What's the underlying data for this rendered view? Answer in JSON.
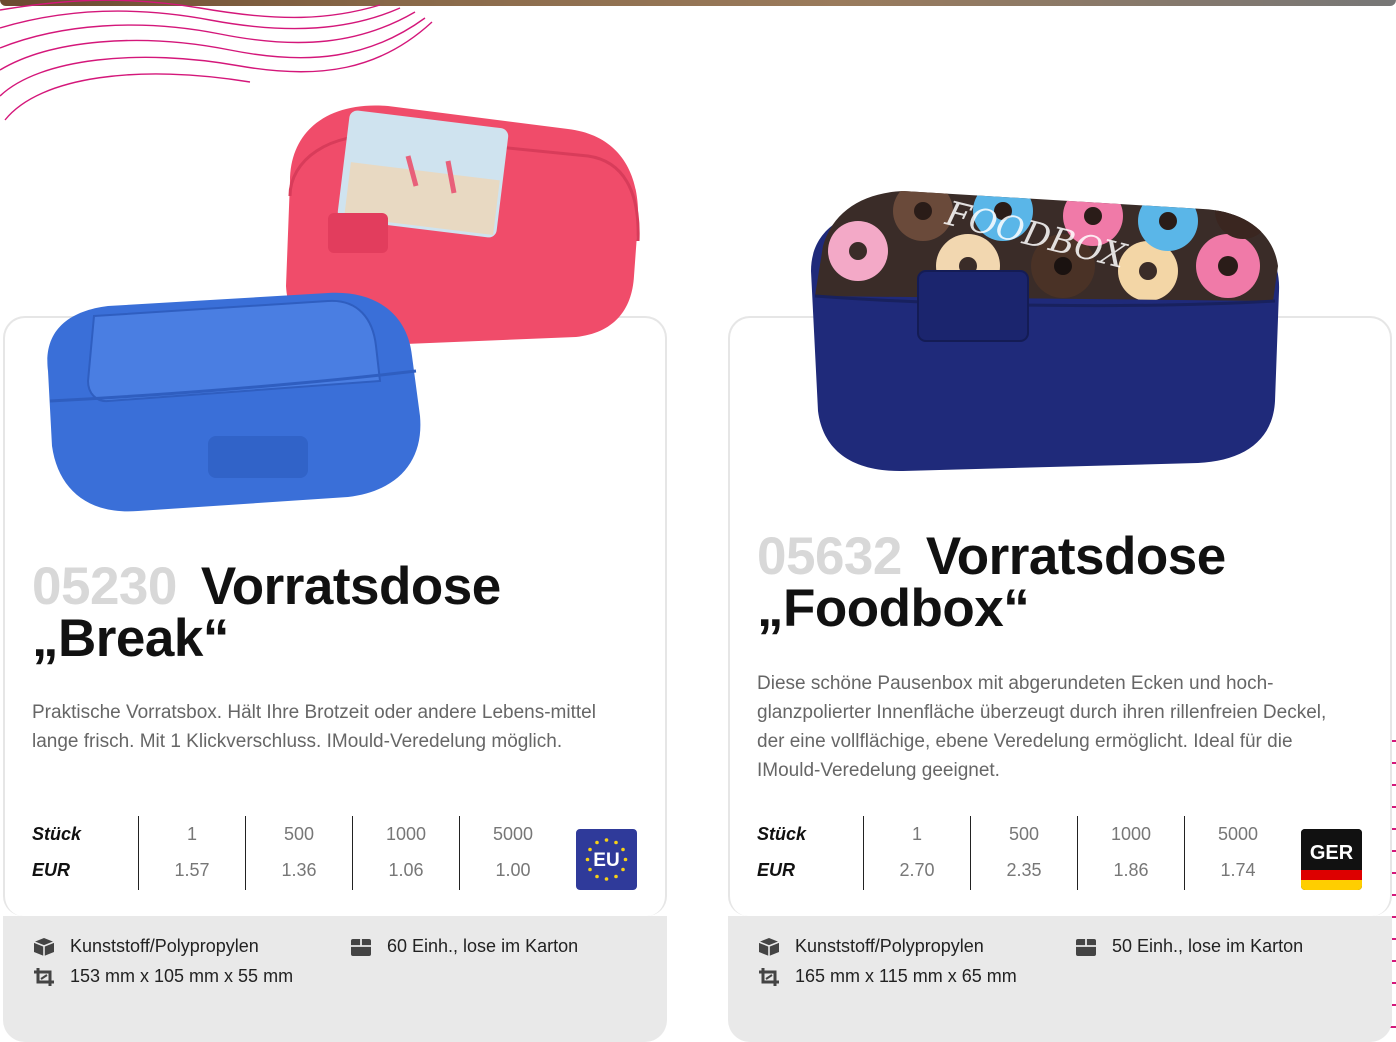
{
  "products": [
    {
      "number": "05230",
      "name_line1": "Vorratsdose",
      "name_line2": "„Break“",
      "description": "Praktische Vorratsbox. Hält Ihre Brotzeit oder andere Lebens-mittel lange frisch. Mit 1 Klickverschluss. IMould-Veredelung möglich.",
      "price_labels": {
        "qty": "Stück",
        "currency": "EUR"
      },
      "quantities": [
        "1",
        "500",
        "1000",
        "5000"
      ],
      "prices": [
        "1.57",
        "1.36",
        "1.06",
        "1.00"
      ],
      "origin_badge": "EU",
      "material": "Kunststoff/Polypropylen",
      "dimensions": "153 mm x 105 mm x 55 mm",
      "packaging": "60 Einh., lose im Karton",
      "colors": {
        "box_1": "#3a6fd8",
        "box_2": "#f0506e"
      }
    },
    {
      "number": "05632",
      "name_line1": "Vorratsdose",
      "name_line2": "„Foodbox“",
      "description": "Diese schöne Pausenbox mit abgerundeten Ecken und hoch-glanzpolierter Innenfläche überzeugt durch ihren rillenfreien Deckel, der eine vollflächige, ebene Veredelung ermöglicht. Ideal für die IMould-Veredelung geeignet.",
      "price_labels": {
        "qty": "Stück",
        "currency": "EUR"
      },
      "quantities": [
        "1",
        "500",
        "1000",
        "5000"
      ],
      "prices": [
        "2.70",
        "2.35",
        "1.86",
        "1.74"
      ],
      "origin_badge": "GER",
      "material": "Kunststoff/Polypropylen",
      "dimensions": "165 mm x 115 mm x 65 mm",
      "packaging": "50 Einh., lose im Karton",
      "lid_print": "FOODBOX",
      "colors": {
        "box": "#1f2a7a"
      }
    }
  ],
  "icons": [
    "box-3d-icon",
    "crop-dimensions-icon",
    "package-icon",
    "eu-flag-icon",
    "german-flag-icon"
  ]
}
